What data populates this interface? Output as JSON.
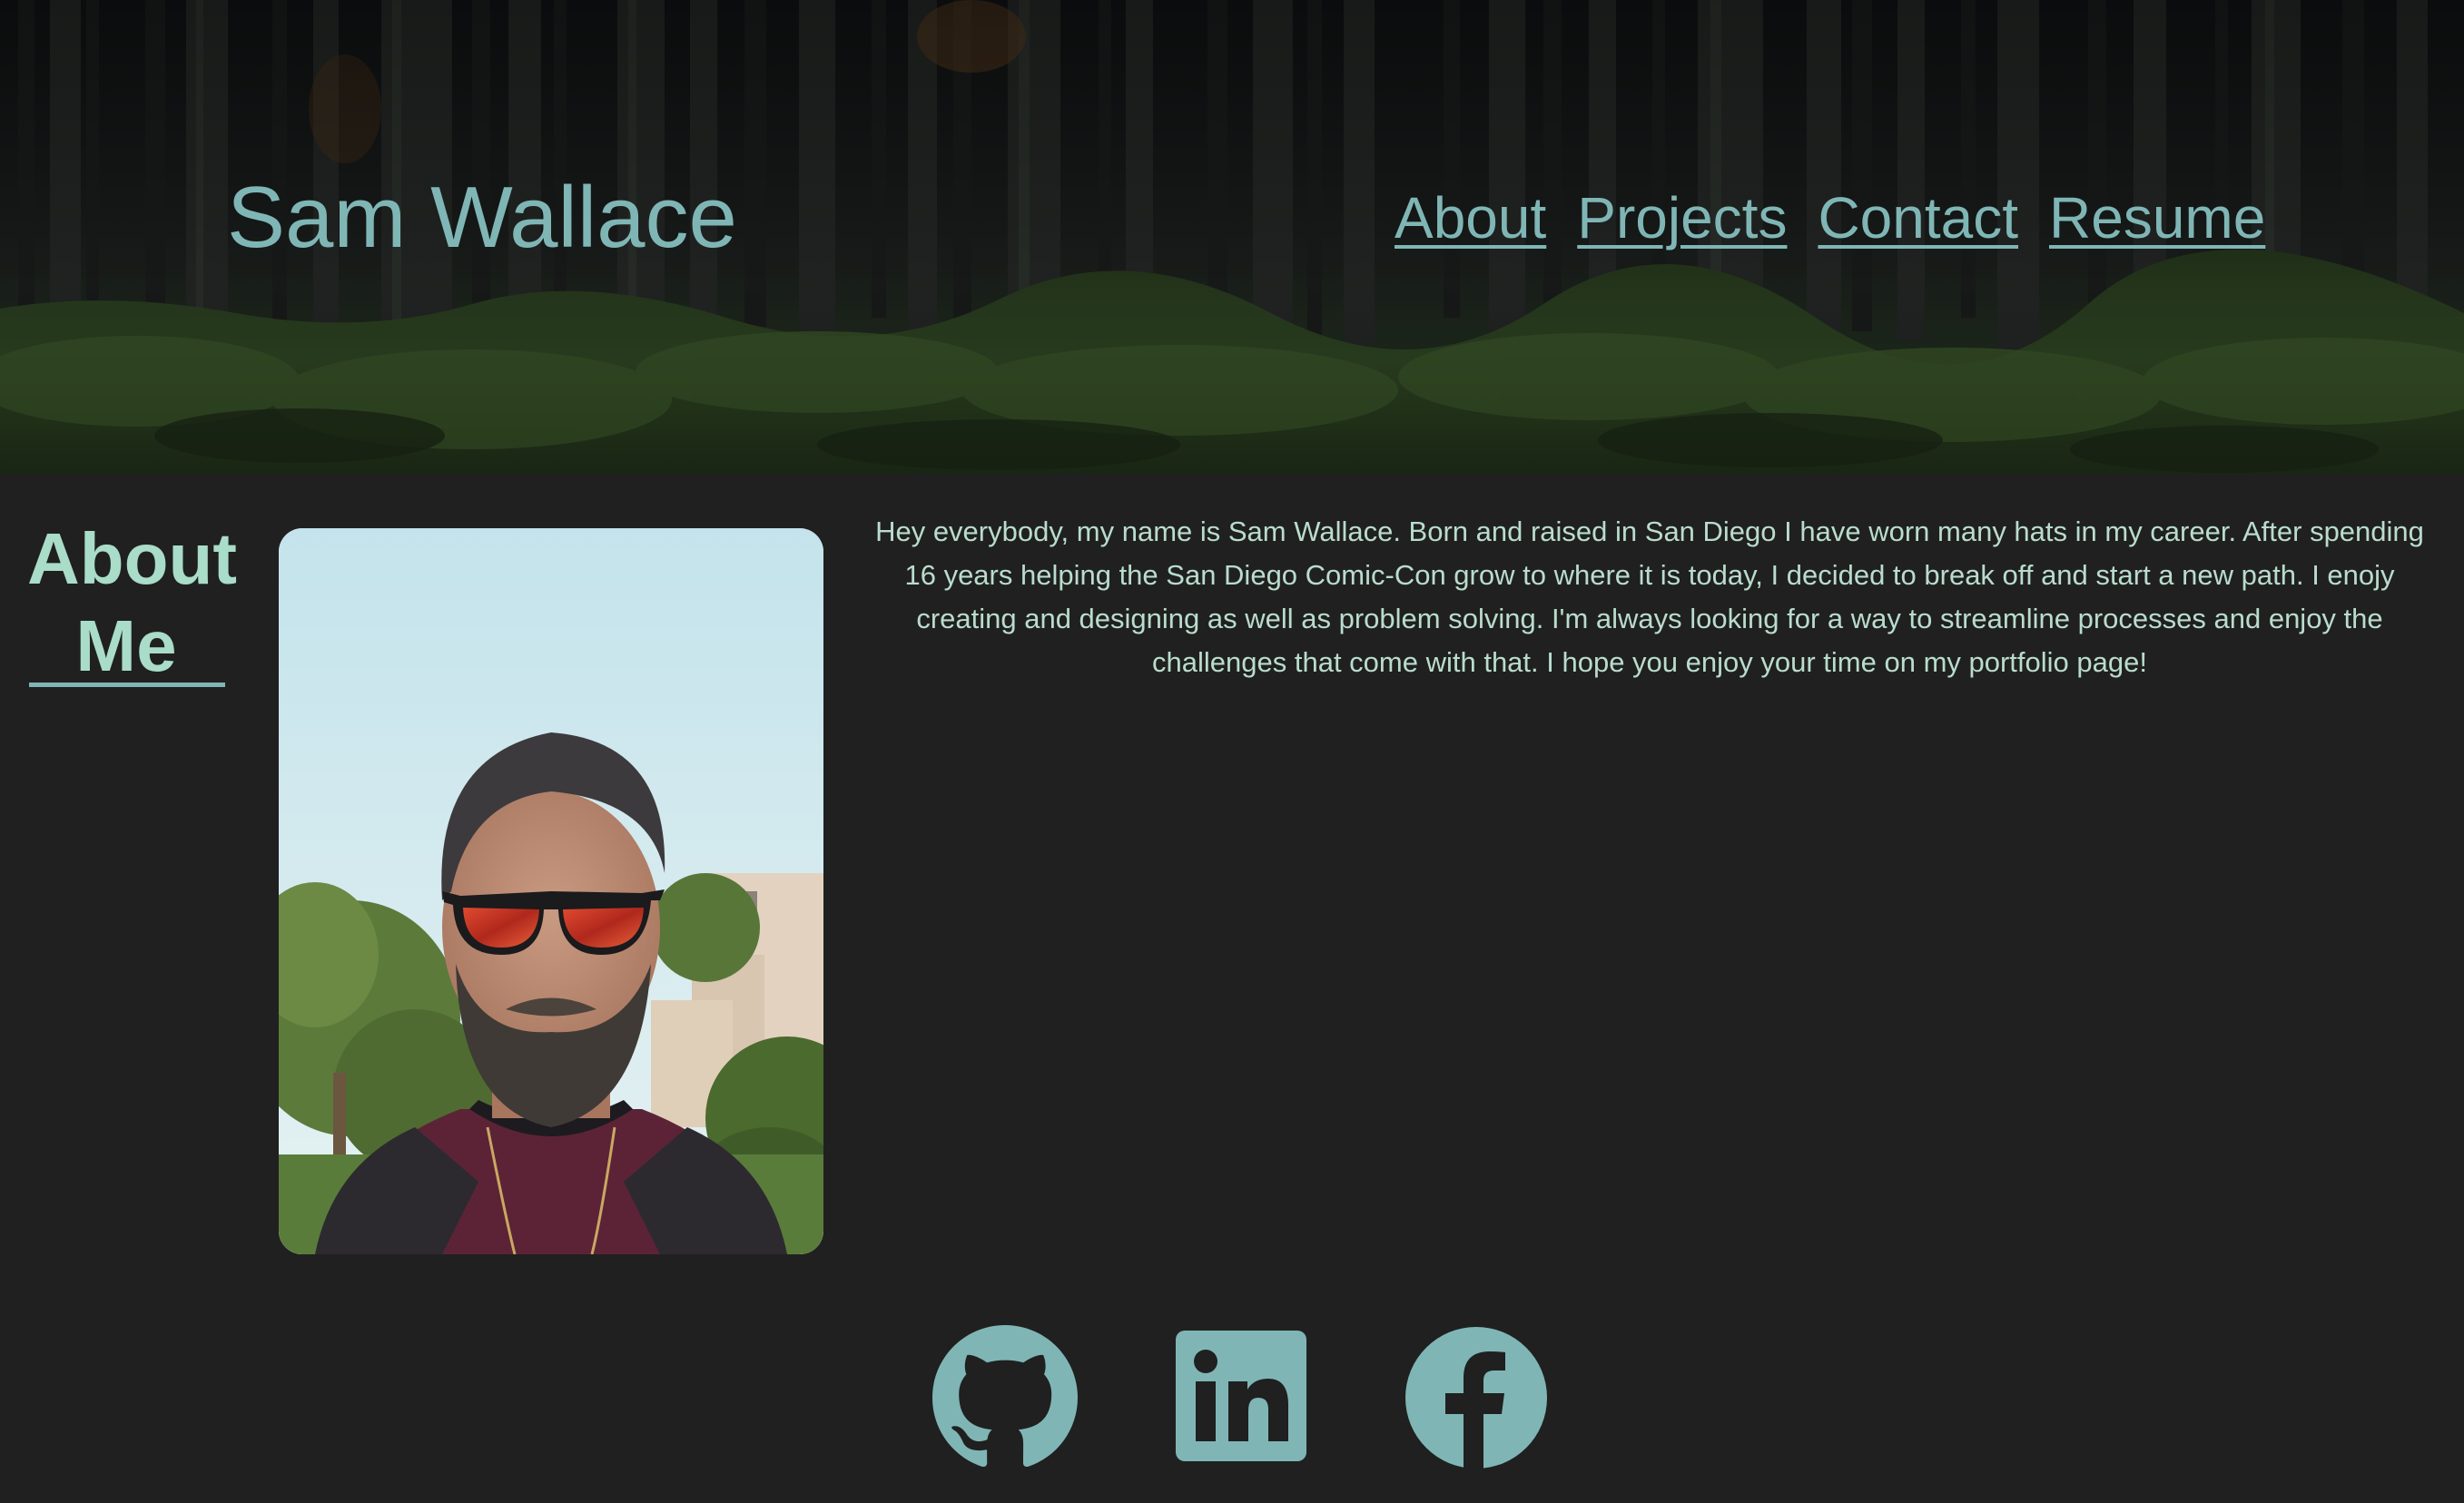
{
  "header": {
    "site_title": "Sam Wallace",
    "nav": [
      {
        "label": "About"
      },
      {
        "label": "Projects"
      },
      {
        "label": "Contact"
      },
      {
        "label": "Resume"
      }
    ]
  },
  "about": {
    "heading_line1": "About",
    "heading_line2": "Me",
    "bio": "Hey everybody, my name is Sam Wallace. Born and raised in San Diego I have worn many hats in my career. After spending 16 years helping the San Diego Comic-Con grow to where it is today, I decided to break off and start a new path. I enojy creating and designing as well as problem solving. I'm always looking for a way to streamline processes and enjoy the challenges that come with that. I hope you enjoy your time on my portfolio page!"
  },
  "social": [
    {
      "icon": "github-icon"
    },
    {
      "icon": "linkedin-icon"
    },
    {
      "icon": "facebook-icon"
    }
  ],
  "colors": {
    "background": "#202020",
    "accent": "#7fb6b5",
    "text": "#b9dccd"
  }
}
